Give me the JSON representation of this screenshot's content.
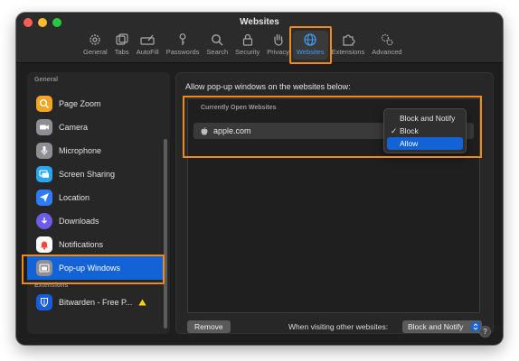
{
  "window": {
    "title": "Websites"
  },
  "toolbar": {
    "items": [
      {
        "label": "General",
        "icon": "gear-icon"
      },
      {
        "label": "Tabs",
        "icon": "tabs-icon"
      },
      {
        "label": "AutoFill",
        "icon": "autofill-icon"
      },
      {
        "label": "Passwords",
        "icon": "key-icon"
      },
      {
        "label": "Search",
        "icon": "search-icon"
      },
      {
        "label": "Security",
        "icon": "lock-icon"
      },
      {
        "label": "Privacy",
        "icon": "hand-icon"
      },
      {
        "label": "Websites",
        "icon": "globe-icon",
        "active": true
      },
      {
        "label": "Extensions",
        "icon": "puzzle-icon"
      },
      {
        "label": "Advanced",
        "icon": "gears-icon"
      }
    ]
  },
  "sidebar": {
    "general_heading": "General",
    "extensions_heading": "Extensions",
    "items": [
      {
        "label": "Page Zoom",
        "icon": "zoom-icon",
        "color": "#f5a524"
      },
      {
        "label": "Camera",
        "icon": "camera-icon",
        "color": "#8e8e93"
      },
      {
        "label": "Microphone",
        "icon": "microphone-icon",
        "color": "#8e8e93"
      },
      {
        "label": "Screen Sharing",
        "icon": "screen-sharing-icon",
        "color": "#2aa6f0"
      },
      {
        "label": "Location",
        "icon": "location-icon",
        "color": "#2f7cf6"
      },
      {
        "label": "Downloads",
        "icon": "downloads-icon",
        "color": "#6c5ce7"
      },
      {
        "label": "Notifications",
        "icon": "notifications-icon",
        "color": "#ff453a"
      },
      {
        "label": "Pop-up Windows",
        "icon": "popup-windows-icon",
        "color": "#8e8e93",
        "selected": true
      }
    ],
    "extensions": [
      {
        "label": "Bitwarden - Free P...",
        "icon": "bitwarden-icon",
        "color": "#175ddc",
        "warning": true
      }
    ]
  },
  "content": {
    "title": "Allow pop-up windows on the websites below:",
    "table_heading": "Currently Open Websites",
    "site": "apple.com",
    "dropdown": {
      "options": [
        "Block and Notify",
        "Block",
        "Allow"
      ],
      "checked": "Block",
      "highlighted": "Allow"
    },
    "remove_label": "Remove",
    "other_sites_label": "When visiting other websites:",
    "other_sites_value": "Block and Notify",
    "help_label": "?"
  },
  "colors": {
    "accent": "#1362d6",
    "highlight_box": "#f08a1c",
    "toolbar_active": "#3f9bf0"
  }
}
